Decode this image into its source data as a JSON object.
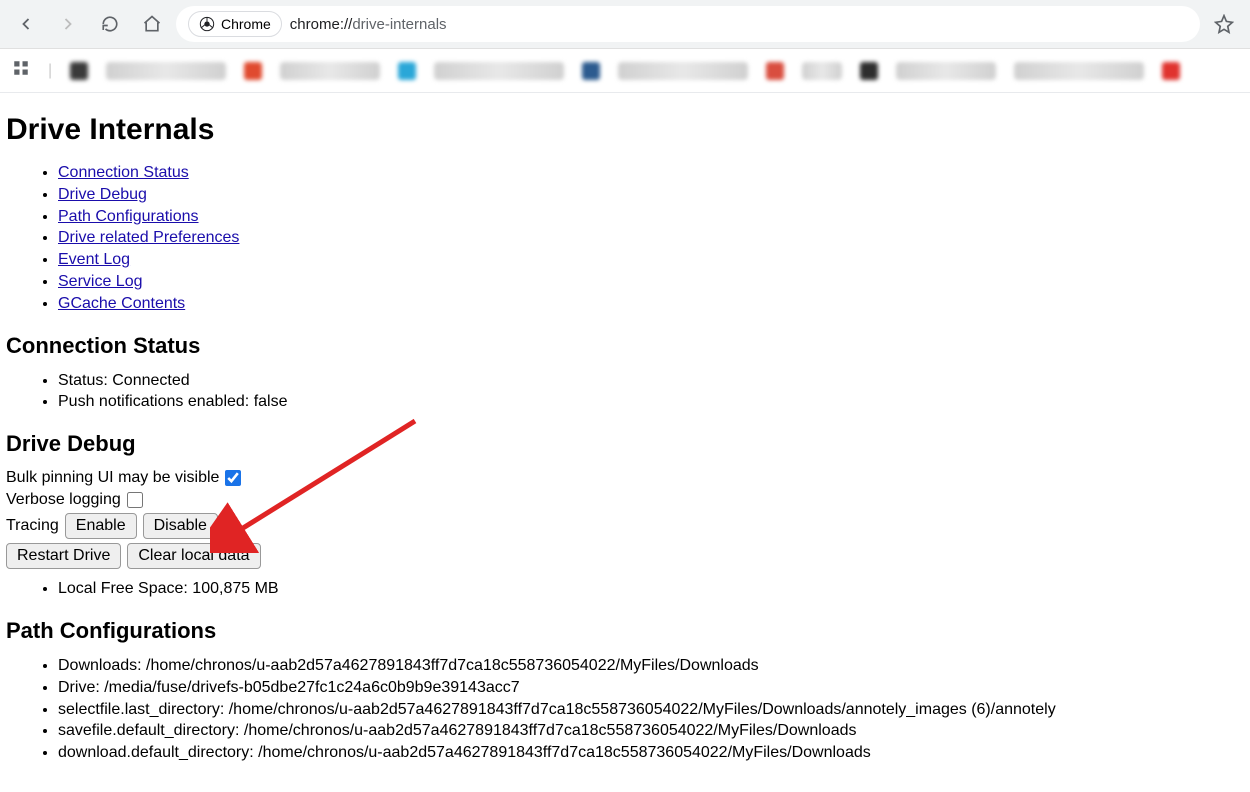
{
  "browser": {
    "chip_label": "Chrome",
    "url_scheme": "chrome://",
    "url_path": "drive-internals"
  },
  "page": {
    "title": "Drive Internals",
    "toc": {
      "0": "Connection Status",
      "1": "Drive Debug",
      "2": "Path Configurations",
      "3": "Drive related Preferences",
      "4": "Event Log",
      "5": "Service Log",
      "6": "GCache Contents"
    },
    "connection": {
      "heading": "Connection Status",
      "status": "Status: Connected",
      "push": "Push notifications enabled: false"
    },
    "debug": {
      "heading": "Drive Debug",
      "bulk_label": "Bulk pinning UI may be visible",
      "verbose_label": "Verbose logging",
      "tracing_label": "Tracing",
      "enable_btn": "Enable",
      "disable_btn": "Disable",
      "restart_btn": "Restart Drive",
      "clear_btn": "Clear local data",
      "free_space": "Local Free Space: 100,875 MB"
    },
    "paths": {
      "heading": "Path Configurations",
      "items": {
        "0": "Downloads: /home/chronos/u-aab2d57a4627891843ff7d7ca18c558736054022/MyFiles/Downloads",
        "1": "Drive: /media/fuse/drivefs-b05dbe27fc1c24a6c0b9b9e39143acc7",
        "2": "selectfile.last_directory: /home/chronos/u-aab2d57a4627891843ff7d7ca18c558736054022/MyFiles/Downloads/annotely_images (6)/annotely",
        "3": "savefile.default_directory: /home/chronos/u-aab2d57a4627891843ff7d7ca18c558736054022/MyFiles/Downloads",
        "4": "download.default_directory: /home/chronos/u-aab2d57a4627891843ff7d7ca18c558736054022/MyFiles/Downloads"
      }
    }
  }
}
